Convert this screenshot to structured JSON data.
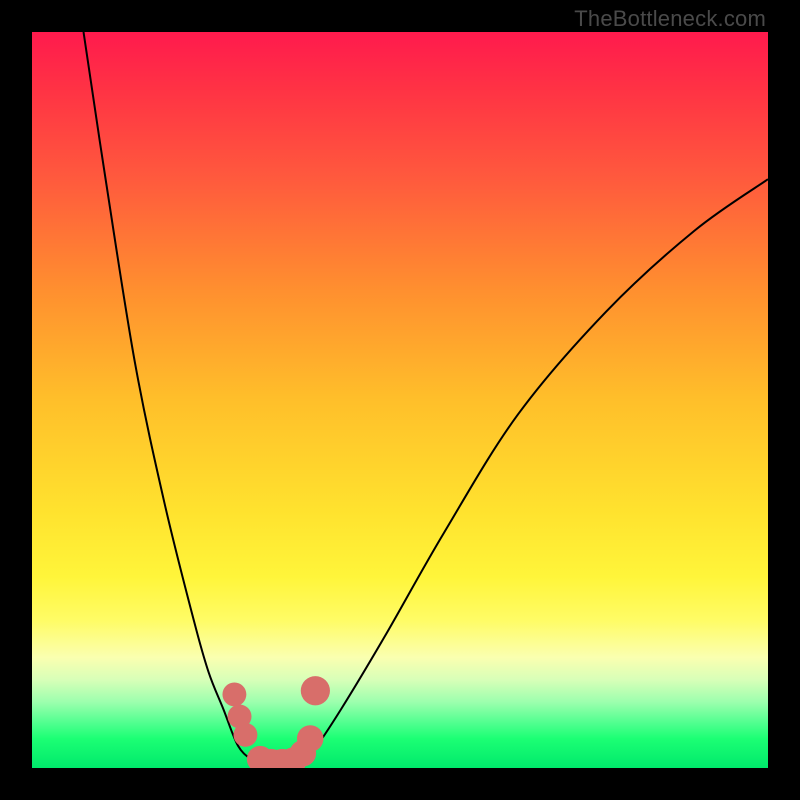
{
  "watermark": "TheBottleneck.com",
  "colors": {
    "frame": "#000000",
    "curve": "#000000",
    "marker": "#d86e6a"
  },
  "chart_data": {
    "type": "line",
    "title": "",
    "xlabel": "",
    "ylabel": "",
    "xlim": [
      0,
      100
    ],
    "ylim": [
      0,
      100
    ],
    "grid": false,
    "legend": false,
    "background": {
      "style": "vertical-gradient",
      "stops": [
        {
          "pos": 0,
          "color": "#ff1a4d"
        },
        {
          "pos": 50,
          "color": "#ffbf2a"
        },
        {
          "pos": 80,
          "color": "#fffc66"
        },
        {
          "pos": 100,
          "color": "#00e96b"
        }
      ]
    },
    "series": [
      {
        "name": "left-curve",
        "x": [
          7,
          10,
          14,
          18,
          22,
          24,
          26,
          28,
          30,
          31.5
        ],
        "y": [
          100,
          80,
          55,
          36,
          20,
          13,
          8,
          3,
          1,
          0
        ]
      },
      {
        "name": "right-curve",
        "x": [
          36,
          38,
          42,
          48,
          56,
          66,
          78,
          90,
          100
        ],
        "y": [
          0,
          2,
          8,
          18,
          32,
          48,
          62,
          73,
          80
        ]
      }
    ],
    "markers": [
      {
        "x": 27.5,
        "y": 10,
        "r": 1.2
      },
      {
        "x": 28.2,
        "y": 7,
        "r": 1.2
      },
      {
        "x": 29.0,
        "y": 4.5,
        "r": 1.2
      },
      {
        "x": 31.0,
        "y": 1.2,
        "r": 1.4
      },
      {
        "x": 32.5,
        "y": 0.8,
        "r": 1.4
      },
      {
        "x": 34.0,
        "y": 0.8,
        "r": 1.4
      },
      {
        "x": 35.5,
        "y": 1.0,
        "r": 1.4
      },
      {
        "x": 36.8,
        "y": 2.0,
        "r": 1.4
      },
      {
        "x": 37.8,
        "y": 4.0,
        "r": 1.4
      },
      {
        "x": 38.5,
        "y": 10.5,
        "r": 1.6
      }
    ]
  }
}
